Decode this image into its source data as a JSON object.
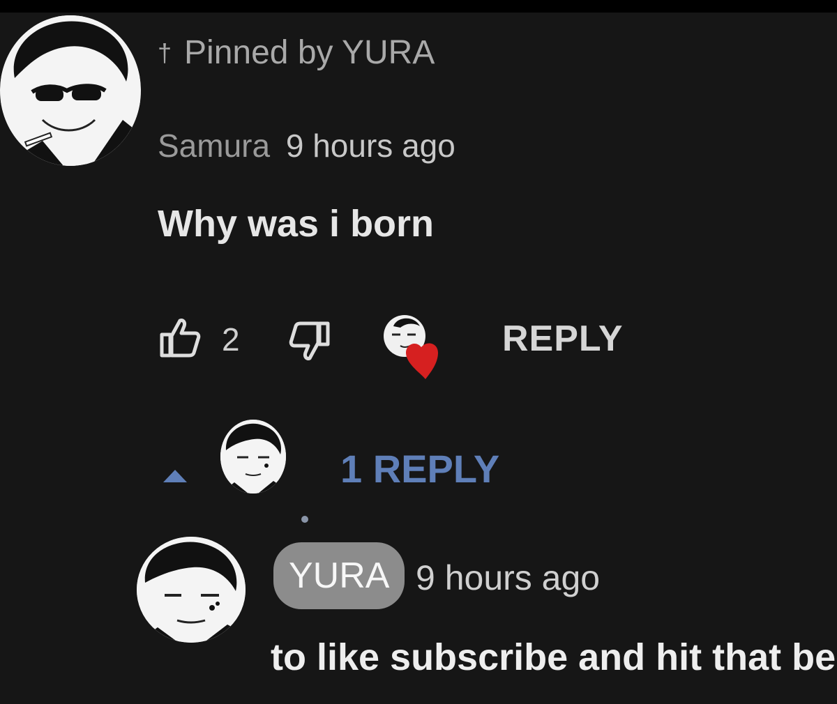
{
  "comment": {
    "pinned_label": "Pinned by YURA",
    "author": "Samura",
    "time": "9 hours ago",
    "text": "Why was i born",
    "likes": "2",
    "reply_label": "REPLY",
    "icons": {
      "pin": "pin-icon",
      "like": "thumbs-up-icon",
      "dislike": "thumbs-down-icon",
      "heart": "creator-heart-icon"
    }
  },
  "replies": {
    "toggle_label": "1 REPLY",
    "caret_icon": "caret-up-icon",
    "color": "#5f7fb8"
  },
  "reply": {
    "author": "YURA",
    "time": "9 hours ago",
    "text": "to like subscribe and hit that bell"
  },
  "colors": {
    "background": "#161616",
    "heart": "#d62020",
    "badge": "#8c8c8c"
  }
}
